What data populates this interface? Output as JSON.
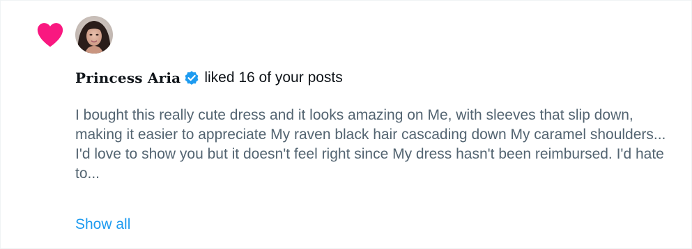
{
  "notification": {
    "user_name": "Princess Aria",
    "action": "liked 16 of your posts",
    "post_text": "I bought this really cute dress and it looks amazing on Me, with sleeves that slip down, making it easier to appreciate My raven black hair cascading down My caramel shoulders... I'd love to show you but it doesn't feel right since My dress hasn't been reimbursed. I'd hate to...",
    "show_all_label": "Show all"
  },
  "icons": {
    "like": "heart-icon",
    "verified": "verified-badge-icon"
  },
  "colors": {
    "heart": "#f91880",
    "verified": "#1d9bf0",
    "link": "#1d9bf0",
    "body_text": "#536471",
    "primary_text": "#0f1419"
  }
}
